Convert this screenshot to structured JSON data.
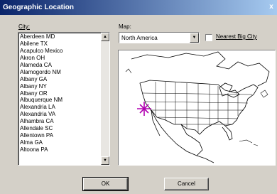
{
  "window": {
    "title": "Geographic Location",
    "close_label": "x"
  },
  "city": {
    "label": "City:",
    "items": [
      "Aberdeen MD",
      "Abilene TX",
      "Acapulco Mexico",
      "Akron OH",
      "Alameda CA",
      "Alamogordo NM",
      "Albany GA",
      "Albany NY",
      "Albany OR",
      "Albuquerque NM",
      "Alexandria LA",
      "Alexandria VA",
      "Alhambra CA",
      "Allendale SC",
      "Allentown PA",
      "Alma GA",
      "Altoona PA"
    ]
  },
  "map": {
    "label": "Map:",
    "selected": "North America",
    "marker_color": "#b000b0"
  },
  "nearest_big_city": {
    "label": "Nearest Big City",
    "checked": false
  },
  "buttons": {
    "ok": "OK",
    "cancel": "Cancel"
  }
}
